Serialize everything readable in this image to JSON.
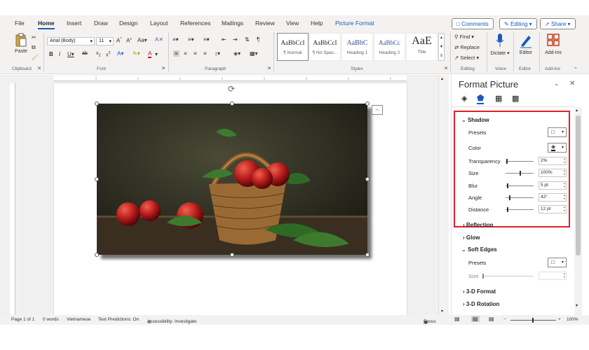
{
  "tabs": [
    "File",
    "Home",
    "Insert",
    "Draw",
    "Design",
    "Layout",
    "References",
    "Mailings",
    "Review",
    "View",
    "Help",
    "Picture Format"
  ],
  "top_buttons": {
    "comments": "Comments",
    "editing": "Editing",
    "share": "Share"
  },
  "clipboard": {
    "paste": "Paste",
    "label": "Clipboard"
  },
  "font": {
    "name": "Arial (Body)",
    "size": "11",
    "label": "Font"
  },
  "paragraph": {
    "label": "Paragraph"
  },
  "styles": {
    "items": [
      {
        "sample": "AaBbCcI",
        "name": "¶ Normal"
      },
      {
        "sample": "AaBbCcI",
        "name": "¶ No Spac..."
      },
      {
        "sample": "AaBbC",
        "name": "Heading 1"
      },
      {
        "sample": "AaBbCc",
        "name": "Heading 2"
      },
      {
        "sample": "AaE",
        "name": "Title"
      }
    ],
    "label": "Styles"
  },
  "editing_group": {
    "find": "Find",
    "replace": "Replace",
    "select": "Select",
    "label": "Editing"
  },
  "voice": {
    "dictate": "Dictate",
    "label": "Voice"
  },
  "editor": {
    "editor": "Editor",
    "label": "Editor"
  },
  "addins": {
    "addins": "Add-ins",
    "label": "Add-ins"
  },
  "pane": {
    "title": "Format Picture",
    "shadow": {
      "heading": "Shadow",
      "presets": "Presets",
      "color": "Color",
      "transparency": {
        "label": "Transparency",
        "value": "2%",
        "level": 0.02
      },
      "size": {
        "label": "Size",
        "value": "100%",
        "level": 0.5
      },
      "blur": {
        "label": "Blur",
        "value": "5 pt",
        "level": 0.05
      },
      "angle": {
        "label": "Angle",
        "value": "42°",
        "level": 0.12
      },
      "distance": {
        "label": "Distance",
        "value": "12 pt",
        "level": 0.06
      }
    },
    "reflection": "Reflection",
    "glow": "Glow",
    "soft_edges": {
      "heading": "Soft Edges",
      "presets": "Presets",
      "size": "Size"
    },
    "d3_format": "3-D Format",
    "d3_rotation": "3-D Rotation"
  },
  "status": {
    "page": "Page 1 of 1",
    "words": "0 words",
    "language": "Vietnamese",
    "predictions": "Text Predictions: On",
    "accessibility": "Accessibility: Investigate",
    "focus": "Focus",
    "zoom": "100%"
  }
}
